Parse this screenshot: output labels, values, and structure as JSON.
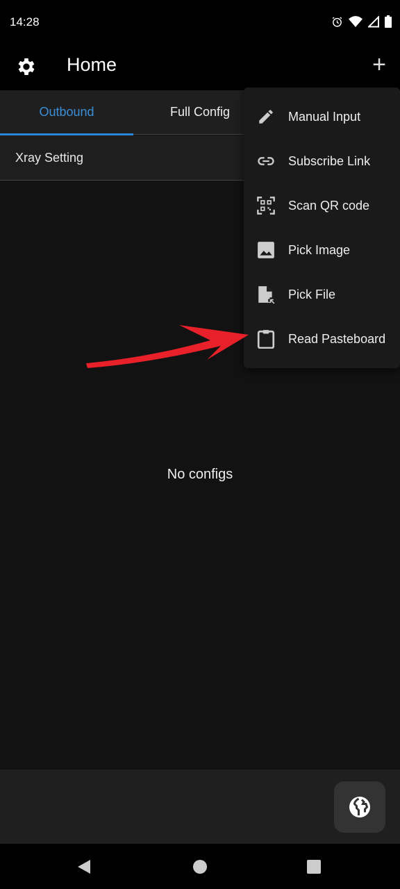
{
  "status_bar": {
    "time": "14:28"
  },
  "app_bar": {
    "title": "Home"
  },
  "tabs": [
    {
      "label": "Outbound",
      "active": true
    },
    {
      "label": "Full Config",
      "active": false
    }
  ],
  "section": {
    "label": "Xray Setting"
  },
  "empty_state": "No configs",
  "menu": {
    "items": [
      {
        "label": "Manual Input",
        "icon": "pencil-icon"
      },
      {
        "label": "Subscribe Link",
        "icon": "link-icon"
      },
      {
        "label": "Scan QR code",
        "icon": "qr-scan-icon"
      },
      {
        "label": "Pick Image",
        "icon": "image-icon"
      },
      {
        "label": "Pick File",
        "icon": "file-icon"
      },
      {
        "label": "Read Pasteboard",
        "icon": "clipboard-icon"
      }
    ]
  },
  "colors": {
    "accent": "#2a86d8",
    "annotation": "#e8202a"
  }
}
